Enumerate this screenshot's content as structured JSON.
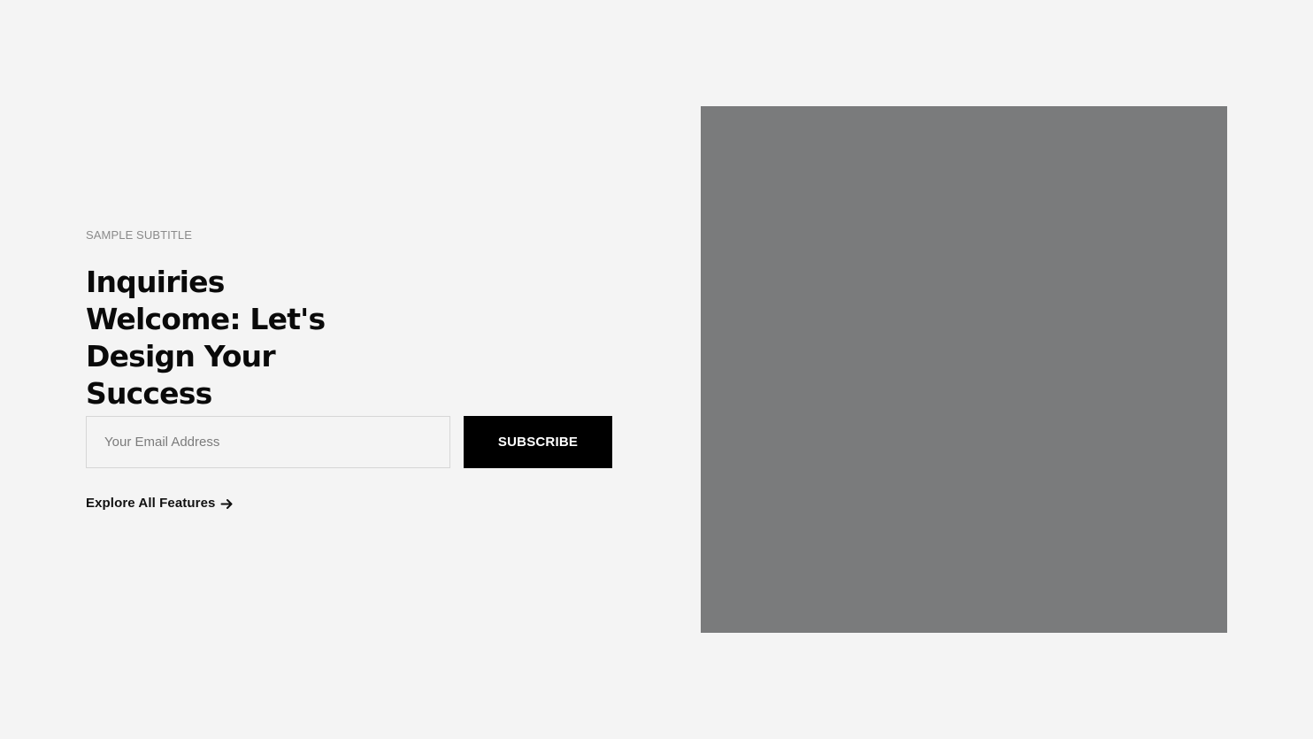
{
  "hero": {
    "subtitle": "SAMPLE SUBTITLE",
    "title": "Inquiries Welcome: Let's Design Your Success",
    "email_placeholder": "Your Email Address",
    "subscribe_label": "SUBSCRIBE",
    "explore_label": "Explore All Features",
    "explore_icon": "arrow-right-icon"
  },
  "colors": {
    "background": "#f4f4f4",
    "button": "#000000",
    "image_placeholder": "#7a7b7c",
    "subtitle": "#8a8a8a"
  }
}
